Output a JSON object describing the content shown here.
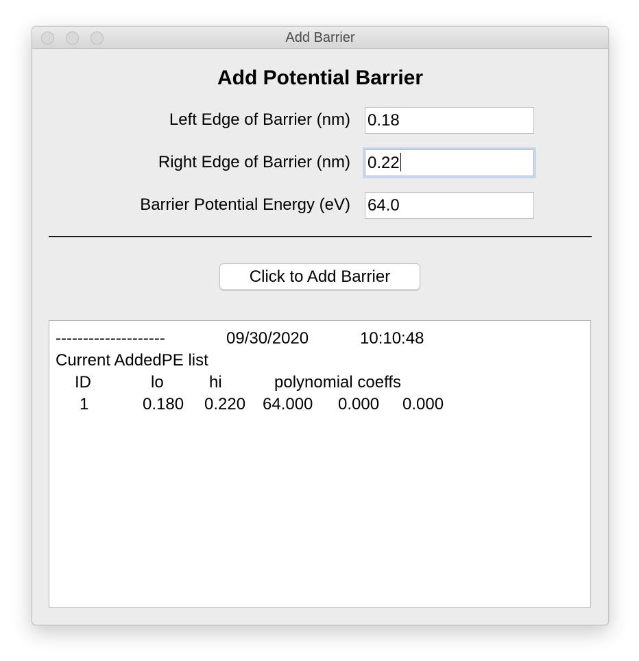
{
  "window": {
    "title": "Add Barrier"
  },
  "form": {
    "heading": "Add Potential Barrier",
    "left_edge_label": "Left Edge of Barrier (nm)",
    "left_edge_value": "0.18",
    "right_edge_label": "Right Edge of Barrier (nm)",
    "right_edge_value": "0.22",
    "energy_label": "Barrier Potential Energy (eV)",
    "energy_value": "64.0",
    "add_button_label": "Click to Add Barrier"
  },
  "log": {
    "separator": "--------------------",
    "date": "09/30/2020",
    "time": "10:10:48",
    "list_title": "Current AddedPE list",
    "headers": {
      "id": "ID",
      "lo": "lo",
      "hi": "hi",
      "coeffs": "polynomial coeffs"
    },
    "rows": [
      {
        "id": "1",
        "lo": "0.180",
        "hi": "0.220",
        "c0": "64.000",
        "c1": "0.000",
        "c2": "0.000"
      }
    ]
  },
  "icons": {
    "close": "close-icon",
    "minimize": "minimize-icon",
    "zoom": "zoom-icon"
  }
}
